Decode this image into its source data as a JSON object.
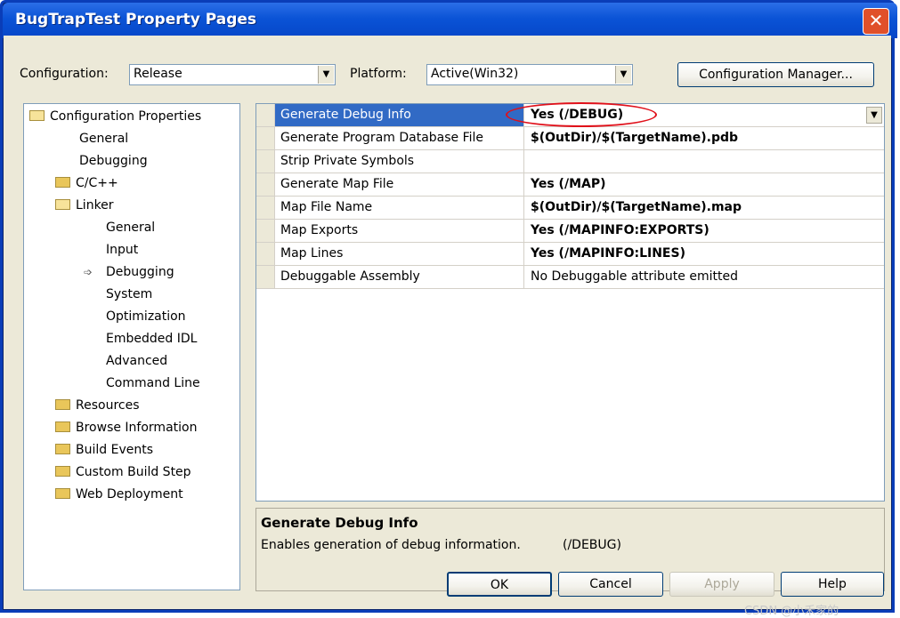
{
  "window": {
    "title": "BugTrapTest Property Pages",
    "close_glyph": "✕"
  },
  "config": {
    "configuration_label": "Configuration:",
    "configuration_value": "Release",
    "platform_label": "Platform:",
    "platform_value": "Active(Win32)",
    "manager_button": "Configuration Manager..."
  },
  "tree": [
    {
      "label": "Configuration Properties",
      "icon": "folder-open-icon"
    },
    {
      "label": "General"
    },
    {
      "label": "Debugging"
    },
    {
      "label": "C/C++",
      "icon": "folder-icon"
    },
    {
      "label": "Linker",
      "icon": "folder-open-icon"
    },
    {
      "label": "General"
    },
    {
      "label": "Input"
    },
    {
      "label": "Debugging",
      "selected_marker": "arrow-right-icon"
    },
    {
      "label": "System"
    },
    {
      "label": "Optimization"
    },
    {
      "label": "Embedded IDL"
    },
    {
      "label": "Advanced"
    },
    {
      "label": "Command Line"
    },
    {
      "label": "Resources",
      "icon": "folder-icon"
    },
    {
      "label": "Browse Information",
      "icon": "folder-icon"
    },
    {
      "label": "Build Events",
      "icon": "folder-icon"
    },
    {
      "label": "Custom Build Step",
      "icon": "folder-icon"
    },
    {
      "label": "Web Deployment",
      "icon": "folder-icon"
    }
  ],
  "properties": [
    {
      "name": "Generate Debug Info",
      "value": "Yes (/DEBUG)",
      "bold": true,
      "selected": true
    },
    {
      "name": "Generate Program Database File",
      "value": "$(OutDir)/$(TargetName).pdb",
      "bold": true
    },
    {
      "name": "Strip Private Symbols",
      "value": ""
    },
    {
      "name": "Generate Map File",
      "value": "Yes (/MAP)",
      "bold": true
    },
    {
      "name": "Map File Name",
      "value": "$(OutDir)/$(TargetName).map",
      "bold": true
    },
    {
      "name": "Map Exports",
      "value": "Yes (/MAPINFO:EXPORTS)",
      "bold": true
    },
    {
      "name": "Map Lines",
      "value": "Yes (/MAPINFO:LINES)",
      "bold": true
    },
    {
      "name": "Debuggable Assembly",
      "value": "No Debuggable attribute emitted"
    }
  ],
  "description": {
    "title": "Generate Debug Info",
    "text": "Enables generation of debug information.",
    "switch": "(/DEBUG)"
  },
  "buttons": {
    "ok": "OK",
    "cancel": "Cancel",
    "apply": "Apply",
    "help": "Help"
  },
  "watermark": "CSDN @小禾家的",
  "colors": {
    "title_bar": "#0a53d6",
    "selection": "#316ac5",
    "highlight_oval": "#e0101a",
    "dialog_face": "#ece9d8"
  }
}
